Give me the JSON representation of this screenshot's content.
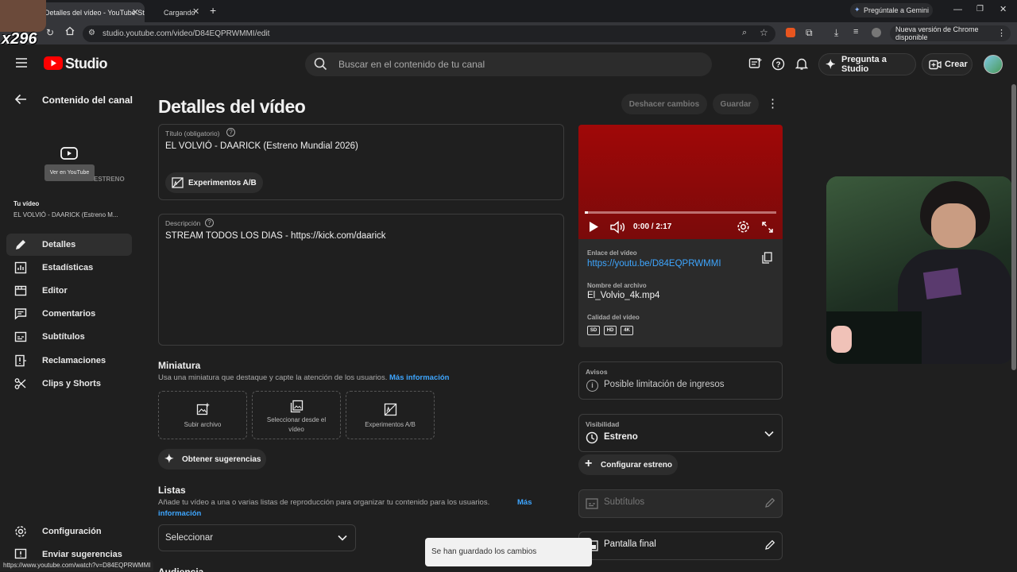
{
  "browser": {
    "tabs": [
      {
        "label": "Detalles del vídeo - YouTube St"
      },
      {
        "label": "Cargando"
      }
    ],
    "url": "studio.youtube.com/video/D84EQPRWMMI/edit",
    "gemini_label": "Pregúntale a Gemini",
    "update_label": "Nueva versión de Chrome disponible",
    "overlay_badge": "x296",
    "status_url": "https://www.youtube.com/watch?v=D84EQPRWMMI"
  },
  "header": {
    "logo_text": "Studio",
    "search_placeholder": "Buscar en el contenido de tu canal",
    "ask_studio": "Pregunta a Studio",
    "create": "Crear"
  },
  "sidebar": {
    "back_label": "Contenido del canal",
    "tooltip": "Ver en YouTube",
    "estreno_tag": "ESTRENO",
    "your_video_label": "Tu vídeo",
    "video_title": "EL VOLVIÓ - DAARICK (Estreno M...",
    "items": [
      {
        "label": "Detalles",
        "icon": "pencil-icon"
      },
      {
        "label": "Estadísticas",
        "icon": "analytics-icon"
      },
      {
        "label": "Editor",
        "icon": "editor-icon"
      },
      {
        "label": "Comentarios",
        "icon": "comments-icon"
      },
      {
        "label": "Subtítulos",
        "icon": "subtitles-icon"
      },
      {
        "label": "Reclamaciones",
        "icon": "claims-icon"
      },
      {
        "label": "Clips y Shorts",
        "icon": "scissors-icon"
      }
    ],
    "settings": "Configuración",
    "feedback": "Enviar sugerencias"
  },
  "main": {
    "page_title": "Detalles del vídeo",
    "undo": "Deshacer cambios",
    "save": "Guardar",
    "title_label": "Título (obligatorio)",
    "title_value": "EL VOLVIÓ - DAARICK (Estreno Mundial 2026)",
    "ab_test": "Experimentos A/B",
    "description_label": "Descripción",
    "description_value": "STREAM TODOS LOS DIAS - https://kick.com/daarick",
    "thumbnail_title": "Miniatura",
    "thumbnail_desc": "Usa una miniatura que destaque y capte la atención de los usuarios.",
    "more_info": "Más información",
    "thumb_options": [
      "Subir archivo",
      "Seleccionar desde el vídeo",
      "Experimentos A/B"
    ],
    "suggestions": "Obtener sugerencias",
    "lists_title": "Listas",
    "lists_desc": "Añade tu vídeo a una o varias listas de reproducción para organizar tu contenido para los usuarios.",
    "lists_more_1": "Más",
    "lists_more_2": "información",
    "lists_select": "Seleccionar",
    "audience_cut": "Audiencia"
  },
  "right": {
    "time": "0:00 / 2:17",
    "link_label": "Enlace del vídeo",
    "link_value": "https://youtu.be/D84EQPRWMMI",
    "filename_label": "Nombre del archivo",
    "filename_value": "El_Volvio_4k.mp4",
    "quality_label": "Calidad del vídeo",
    "qualities": [
      "SD",
      "HD",
      "4K"
    ],
    "warnings_label": "Avisos",
    "warnings_value": "Posible limitación de ingresos",
    "visibility_label": "Visibilidad",
    "visibility_value": "Estreno",
    "configure_premiere": "Configurar estreno",
    "subtitles": "Subtítulos",
    "end_screen": "Pantalla final"
  },
  "toast": "Se han guardado los cambios",
  "colors": {
    "accent": "#3ea6ff",
    "brand": "#ff0000",
    "bg": "#1f1f1f"
  }
}
